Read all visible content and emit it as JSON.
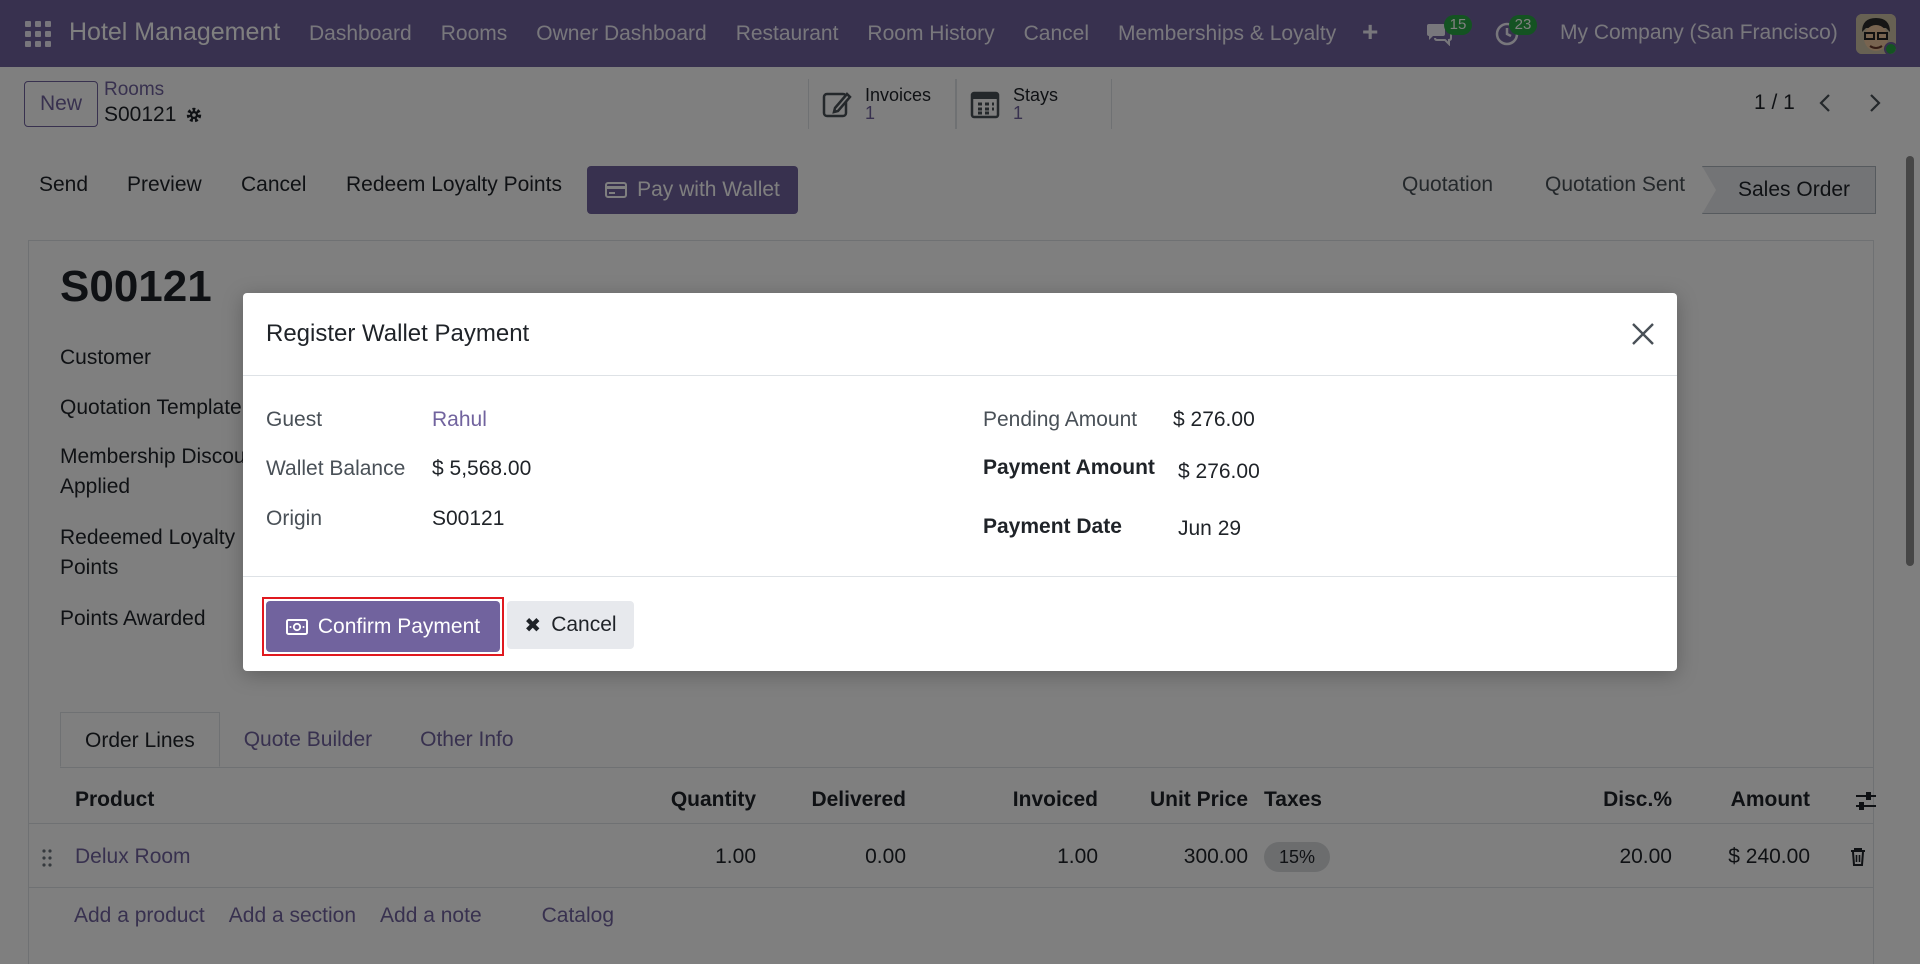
{
  "nav": {
    "brand": "Hotel Management",
    "items": [
      "Dashboard",
      "Rooms",
      "Owner Dashboard",
      "Restaurant",
      "Room History",
      "Cancel",
      "Memberships & Loyalty"
    ],
    "messages_count": "15",
    "activities_count": "23",
    "company": "My Company (San Francisco)"
  },
  "control_panel": {
    "new_label": "New",
    "breadcrumb_parent": "Rooms",
    "breadcrumb_current": "S00121",
    "smart_buttons": [
      {
        "label": "Invoices",
        "count": "1",
        "icon": "edit-icon"
      },
      {
        "label": "Stays",
        "count": "1",
        "icon": "calendar-icon"
      }
    ],
    "pager": "1 / 1"
  },
  "status_bar": {
    "buttons": [
      "Send",
      "Preview",
      "Cancel",
      "Redeem Loyalty Points"
    ],
    "wallet_button": "Pay with Wallet",
    "stages": [
      "Quotation",
      "Quotation Sent",
      "Sales Order"
    ],
    "active_stage": "Sales Order"
  },
  "form": {
    "title": "S00121",
    "labels": {
      "customer": "Customer",
      "quotation_template": "Quotation Template",
      "membership_line1": "Membership Discount",
      "membership_line2": "Applied",
      "redeemed_line1": "Redeemed Loyalty",
      "redeemed_line2": "Points",
      "points_awarded": "Points Awarded"
    }
  },
  "tabs": [
    "Order Lines",
    "Quote Builder",
    "Other Info"
  ],
  "order_lines": {
    "columns": [
      "Product",
      "Quantity",
      "Delivered",
      "Invoiced",
      "Unit Price",
      "Taxes",
      "Disc.%",
      "Amount"
    ],
    "rows": [
      {
        "product": "Delux Room",
        "quantity": "1.00",
        "delivered": "0.00",
        "invoiced": "1.00",
        "unit_price": "300.00",
        "taxes": "15%",
        "discount": "20.00",
        "amount": "$ 240.00"
      }
    ],
    "add_links": [
      "Add a product",
      "Add a section",
      "Add a note",
      "Catalog"
    ]
  },
  "dialog": {
    "title": "Register Wallet Payment",
    "guest_label": "Guest",
    "guest_value": "Rahul",
    "wallet_balance_label": "Wallet Balance",
    "wallet_balance_value": "$ 5,568.00",
    "origin_label": "Origin",
    "origin_value": "S00121",
    "pending_amount_label": "Pending Amount",
    "pending_amount_value": "$ 276.00",
    "payment_amount_label": "Payment Amount",
    "payment_amount_value": "$ 276.00",
    "payment_date_label": "Payment Date",
    "payment_date_value": "Jun 29",
    "confirm_label": "Confirm Payment",
    "cancel_label": "Cancel"
  },
  "colors": {
    "brand": "#71639e",
    "highlight": "#e0191f",
    "badge": "#28a745"
  }
}
